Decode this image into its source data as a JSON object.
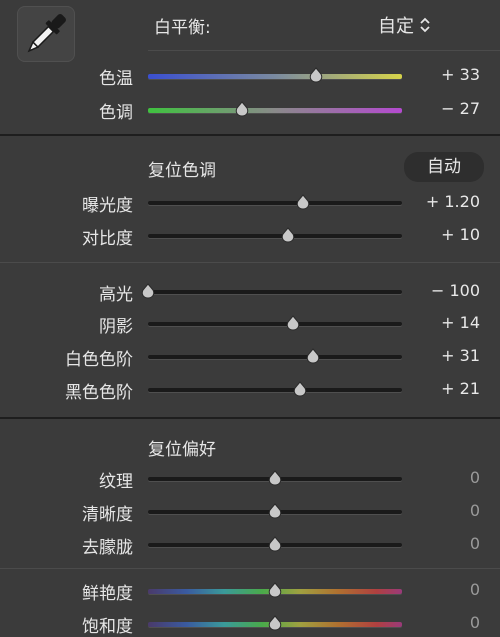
{
  "white_balance": {
    "label": "白平衡:",
    "preset": "自定",
    "preset_chevron": "⌃⌄",
    "tool_icon": "eyedropper-icon",
    "sliders": [
      {
        "key": "temp",
        "label": "色温",
        "value_text": "+ 33",
        "position": 0.66
      },
      {
        "key": "tint",
        "label": "色调",
        "value_text": "− 27",
        "position": 0.37
      }
    ]
  },
  "tone": {
    "reset_label": "复位色调",
    "auto_label": "自动",
    "sliders_basic": [
      {
        "key": "exposure",
        "label": "曝光度",
        "value_text": "+ 1.20",
        "position": 0.61
      },
      {
        "key": "contrast",
        "label": "对比度",
        "value_text": "+ 10",
        "position": 0.55
      }
    ],
    "sliders_range": [
      {
        "key": "highlights",
        "label": "高光",
        "value_text": "− 100",
        "position": 0.0
      },
      {
        "key": "shadows",
        "label": "阴影",
        "value_text": "+ 14",
        "position": 0.57
      },
      {
        "key": "whites",
        "label": "白色色阶",
        "value_text": "+ 31",
        "position": 0.65
      },
      {
        "key": "blacks",
        "label": "黑色色阶",
        "value_text": "+ 21",
        "position": 0.6
      }
    ]
  },
  "presence": {
    "reset_label": "复位偏好",
    "sliders_texture": [
      {
        "key": "texture",
        "label": "纹理",
        "value_text": "0",
        "position": 0.5
      },
      {
        "key": "clarity",
        "label": "清晰度",
        "value_text": "0",
        "position": 0.5
      },
      {
        "key": "dehaze",
        "label": "去朦胧",
        "value_text": "0",
        "position": 0.5
      }
    ],
    "sliders_color": [
      {
        "key": "vibrance",
        "label": "鲜艳度",
        "value_text": "0",
        "position": 0.5
      },
      {
        "key": "saturation",
        "label": "饱和度",
        "value_text": "0",
        "position": 0.5
      }
    ]
  },
  "colors": {
    "panel_bg": "#3b3b3b",
    "separator": "#1e1e1e",
    "thumb": "#c8c8c8",
    "temp_left": "#3a4fd0",
    "temp_right": "#d6d34a",
    "tint_left": "#3fc23f",
    "tint_right": "#b44ad0"
  }
}
